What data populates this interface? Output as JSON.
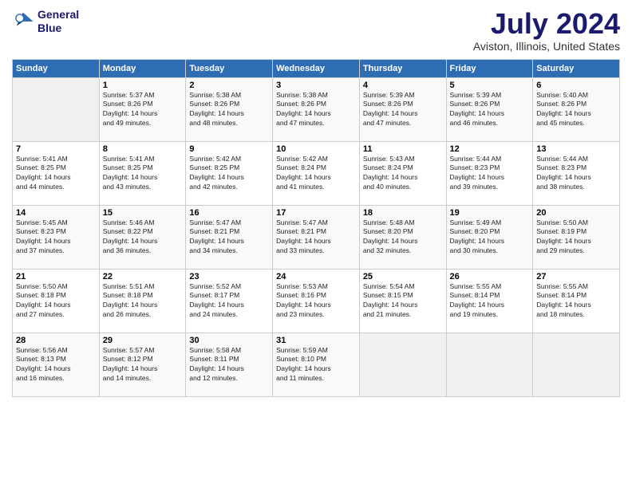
{
  "logo": {
    "line1": "General",
    "line2": "Blue"
  },
  "title": "July 2024",
  "subtitle": "Aviston, Illinois, United States",
  "header_colors": {
    "bg": "#2e6db4",
    "text": "#ffffff"
  },
  "days_of_week": [
    "Sunday",
    "Monday",
    "Tuesday",
    "Wednesday",
    "Thursday",
    "Friday",
    "Saturday"
  ],
  "weeks": [
    [
      {
        "date": "",
        "info": ""
      },
      {
        "date": "1",
        "info": "Sunrise: 5:37 AM\nSunset: 8:26 PM\nDaylight: 14 hours\nand 49 minutes."
      },
      {
        "date": "2",
        "info": "Sunrise: 5:38 AM\nSunset: 8:26 PM\nDaylight: 14 hours\nand 48 minutes."
      },
      {
        "date": "3",
        "info": "Sunrise: 5:38 AM\nSunset: 8:26 PM\nDaylight: 14 hours\nand 47 minutes."
      },
      {
        "date": "4",
        "info": "Sunrise: 5:39 AM\nSunset: 8:26 PM\nDaylight: 14 hours\nand 47 minutes."
      },
      {
        "date": "5",
        "info": "Sunrise: 5:39 AM\nSunset: 8:26 PM\nDaylight: 14 hours\nand 46 minutes."
      },
      {
        "date": "6",
        "info": "Sunrise: 5:40 AM\nSunset: 8:26 PM\nDaylight: 14 hours\nand 45 minutes."
      }
    ],
    [
      {
        "date": "7",
        "info": "Sunrise: 5:41 AM\nSunset: 8:25 PM\nDaylight: 14 hours\nand 44 minutes."
      },
      {
        "date": "8",
        "info": "Sunrise: 5:41 AM\nSunset: 8:25 PM\nDaylight: 14 hours\nand 43 minutes."
      },
      {
        "date": "9",
        "info": "Sunrise: 5:42 AM\nSunset: 8:25 PM\nDaylight: 14 hours\nand 42 minutes."
      },
      {
        "date": "10",
        "info": "Sunrise: 5:42 AM\nSunset: 8:24 PM\nDaylight: 14 hours\nand 41 minutes."
      },
      {
        "date": "11",
        "info": "Sunrise: 5:43 AM\nSunset: 8:24 PM\nDaylight: 14 hours\nand 40 minutes."
      },
      {
        "date": "12",
        "info": "Sunrise: 5:44 AM\nSunset: 8:23 PM\nDaylight: 14 hours\nand 39 minutes."
      },
      {
        "date": "13",
        "info": "Sunrise: 5:44 AM\nSunset: 8:23 PM\nDaylight: 14 hours\nand 38 minutes."
      }
    ],
    [
      {
        "date": "14",
        "info": "Sunrise: 5:45 AM\nSunset: 8:23 PM\nDaylight: 14 hours\nand 37 minutes."
      },
      {
        "date": "15",
        "info": "Sunrise: 5:46 AM\nSunset: 8:22 PM\nDaylight: 14 hours\nand 36 minutes."
      },
      {
        "date": "16",
        "info": "Sunrise: 5:47 AM\nSunset: 8:21 PM\nDaylight: 14 hours\nand 34 minutes."
      },
      {
        "date": "17",
        "info": "Sunrise: 5:47 AM\nSunset: 8:21 PM\nDaylight: 14 hours\nand 33 minutes."
      },
      {
        "date": "18",
        "info": "Sunrise: 5:48 AM\nSunset: 8:20 PM\nDaylight: 14 hours\nand 32 minutes."
      },
      {
        "date": "19",
        "info": "Sunrise: 5:49 AM\nSunset: 8:20 PM\nDaylight: 14 hours\nand 30 minutes."
      },
      {
        "date": "20",
        "info": "Sunrise: 5:50 AM\nSunset: 8:19 PM\nDaylight: 14 hours\nand 29 minutes."
      }
    ],
    [
      {
        "date": "21",
        "info": "Sunrise: 5:50 AM\nSunset: 8:18 PM\nDaylight: 14 hours\nand 27 minutes."
      },
      {
        "date": "22",
        "info": "Sunrise: 5:51 AM\nSunset: 8:18 PM\nDaylight: 14 hours\nand 26 minutes."
      },
      {
        "date": "23",
        "info": "Sunrise: 5:52 AM\nSunset: 8:17 PM\nDaylight: 14 hours\nand 24 minutes."
      },
      {
        "date": "24",
        "info": "Sunrise: 5:53 AM\nSunset: 8:16 PM\nDaylight: 14 hours\nand 23 minutes."
      },
      {
        "date": "25",
        "info": "Sunrise: 5:54 AM\nSunset: 8:15 PM\nDaylight: 14 hours\nand 21 minutes."
      },
      {
        "date": "26",
        "info": "Sunrise: 5:55 AM\nSunset: 8:14 PM\nDaylight: 14 hours\nand 19 minutes."
      },
      {
        "date": "27",
        "info": "Sunrise: 5:55 AM\nSunset: 8:14 PM\nDaylight: 14 hours\nand 18 minutes."
      }
    ],
    [
      {
        "date": "28",
        "info": "Sunrise: 5:56 AM\nSunset: 8:13 PM\nDaylight: 14 hours\nand 16 minutes."
      },
      {
        "date": "29",
        "info": "Sunrise: 5:57 AM\nSunset: 8:12 PM\nDaylight: 14 hours\nand 14 minutes."
      },
      {
        "date": "30",
        "info": "Sunrise: 5:58 AM\nSunset: 8:11 PM\nDaylight: 14 hours\nand 12 minutes."
      },
      {
        "date": "31",
        "info": "Sunrise: 5:59 AM\nSunset: 8:10 PM\nDaylight: 14 hours\nand 11 minutes."
      },
      {
        "date": "",
        "info": ""
      },
      {
        "date": "",
        "info": ""
      },
      {
        "date": "",
        "info": ""
      }
    ]
  ]
}
